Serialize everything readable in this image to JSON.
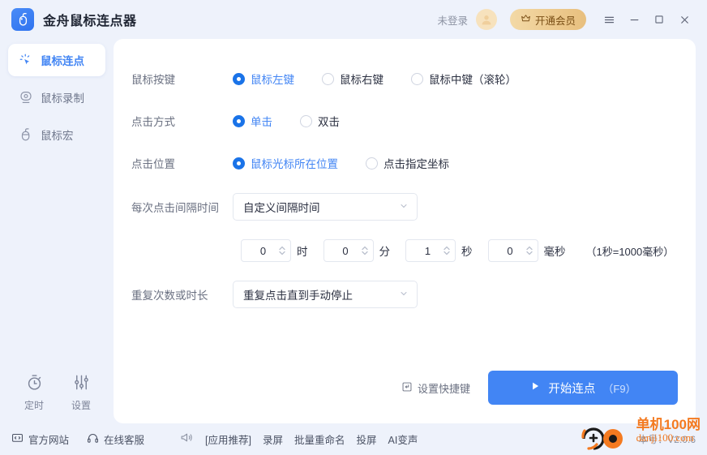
{
  "titlebar": {
    "app_title": "金舟鼠标连点器",
    "logo_icon": "mouse-logo-icon",
    "login_text": "未登录",
    "avatar_icon": "user-avatar-icon",
    "vip_label": "开通会员",
    "vip_icon": "crown-icon",
    "menu_icon": "hamburger-menu-icon",
    "minimize_icon": "minimize-icon",
    "maximize_icon": "maximize-icon",
    "close_icon": "close-icon"
  },
  "sidebar": {
    "items": [
      {
        "label": "鼠标连点",
        "icon": "click-cursor-icon",
        "active": true
      },
      {
        "label": "鼠标录制",
        "icon": "record-camera-icon",
        "active": false
      },
      {
        "label": "鼠标宏",
        "icon": "mouse-macro-icon",
        "active": false
      }
    ],
    "tools": [
      {
        "label": "定时",
        "icon": "stopwatch-icon"
      },
      {
        "label": "设置",
        "icon": "sliders-settings-icon"
      }
    ]
  },
  "form": {
    "rows": [
      {
        "label": "鼠标按键",
        "options": [
          {
            "label": "鼠标左键",
            "selected": true
          },
          {
            "label": "鼠标右键",
            "selected": false
          },
          {
            "label": "鼠标中键（滚轮）",
            "selected": false
          }
        ]
      },
      {
        "label": "点击方式",
        "options": [
          {
            "label": "单击",
            "selected": true
          },
          {
            "label": "双击",
            "selected": false
          }
        ]
      },
      {
        "label": "点击位置",
        "options": [
          {
            "label": "鼠标光标所在位置",
            "selected": true
          },
          {
            "label": "点击指定坐标",
            "selected": false
          }
        ]
      }
    ],
    "interval": {
      "label": "每次点击间隔时间",
      "value": "自定义间隔时间",
      "chevron": "chevron-down-icon"
    },
    "time": {
      "hours": {
        "value": "0",
        "unit": "时"
      },
      "minutes": {
        "value": "0",
        "unit": "分"
      },
      "seconds": {
        "value": "1",
        "unit": "秒"
      },
      "millis": {
        "value": "0",
        "unit": "毫秒"
      },
      "hint": "（1秒=1000毫秒）"
    },
    "repeat": {
      "label": "重复次数或时长",
      "value": "重复点击直到手动停止",
      "chevron": "chevron-down-icon"
    }
  },
  "card_footer": {
    "shortcut_label": "设置快捷键",
    "shortcut_icon": "keyboard-shortcut-icon",
    "start_label": "开始连点",
    "start_hotkey": "（F9）",
    "play_icon": "play-triangle-icon"
  },
  "statusbar": {
    "website_label": "官方网站",
    "website_icon": "monitor-code-icon",
    "support_label": "在线客服",
    "support_icon": "headset-icon",
    "promo_icon": "megaphone-icon",
    "promo_items": [
      "[应用推荐]",
      "录屏",
      "批量重命名",
      "投屏",
      "AI变声"
    ],
    "version": "本号：V2.0.6"
  },
  "watermark": {
    "line1": "单机100网",
    "line2": "danji100.com",
    "logo_icon": "danji100-logo-icon"
  },
  "colors": {
    "accent": "#4285f4",
    "radio_selected": "#1a73e8",
    "app_bg": "#eef2fb",
    "card_bg": "#ffffff",
    "vip_gold": "#e8bf7e",
    "watermark_orange": "#f47a20"
  }
}
